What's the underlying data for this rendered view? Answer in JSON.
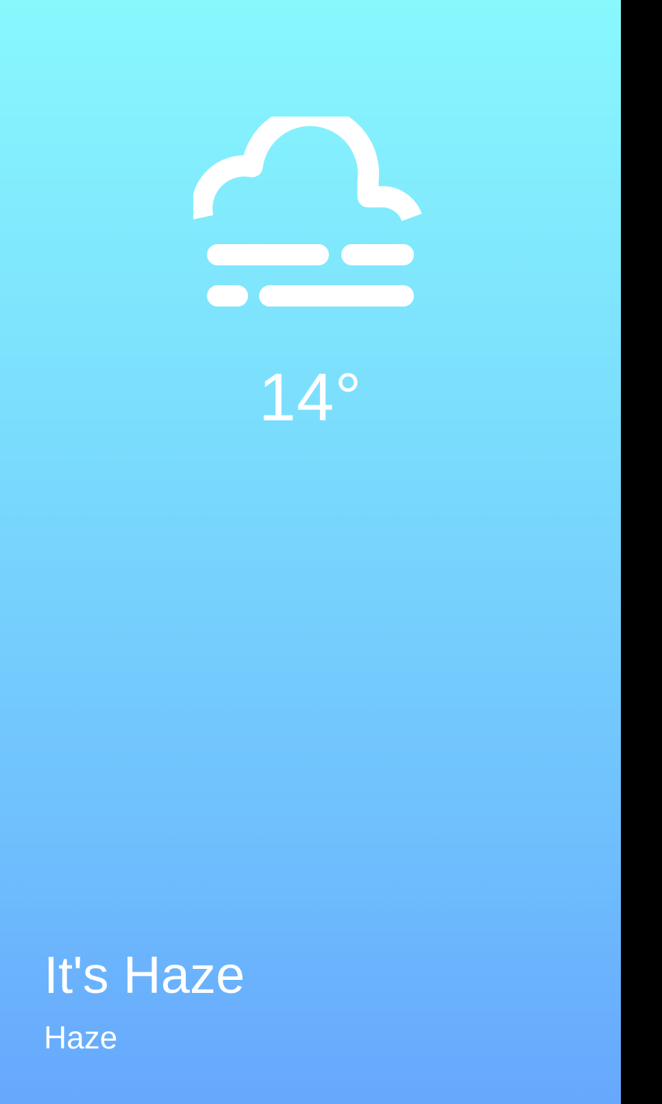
{
  "weather": {
    "icon": "haze-icon",
    "temperature": "14°",
    "headline": "It's Haze",
    "condition": "Haze"
  },
  "colors": {
    "gradient_top": "#88f8fd",
    "gradient_bottom": "#67a7fd",
    "text": "#ffffff",
    "frame": "#000000"
  }
}
